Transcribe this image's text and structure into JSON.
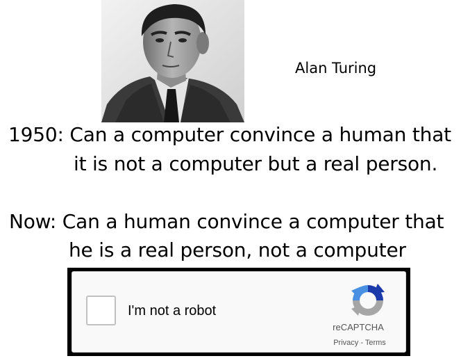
{
  "photo": {
    "caption": "Alan Turing"
  },
  "text": {
    "line1": "1950: Can a computer convince a human that",
    "line2": "it is not a computer but a real person.",
    "line3": "Now: Can a human convince a computer that",
    "line4": "he is a real person, not a computer"
  },
  "captcha": {
    "label": "I'm not a robot",
    "brand": "reCAPTCHA",
    "privacy": "Privacy",
    "separator": " - ",
    "terms": "Terms",
    "icon": "recaptcha-logo",
    "colors": {
      "blue": "#4a90e2",
      "dark_blue": "#1c3aa9",
      "gray": "#a6a6a6"
    }
  }
}
